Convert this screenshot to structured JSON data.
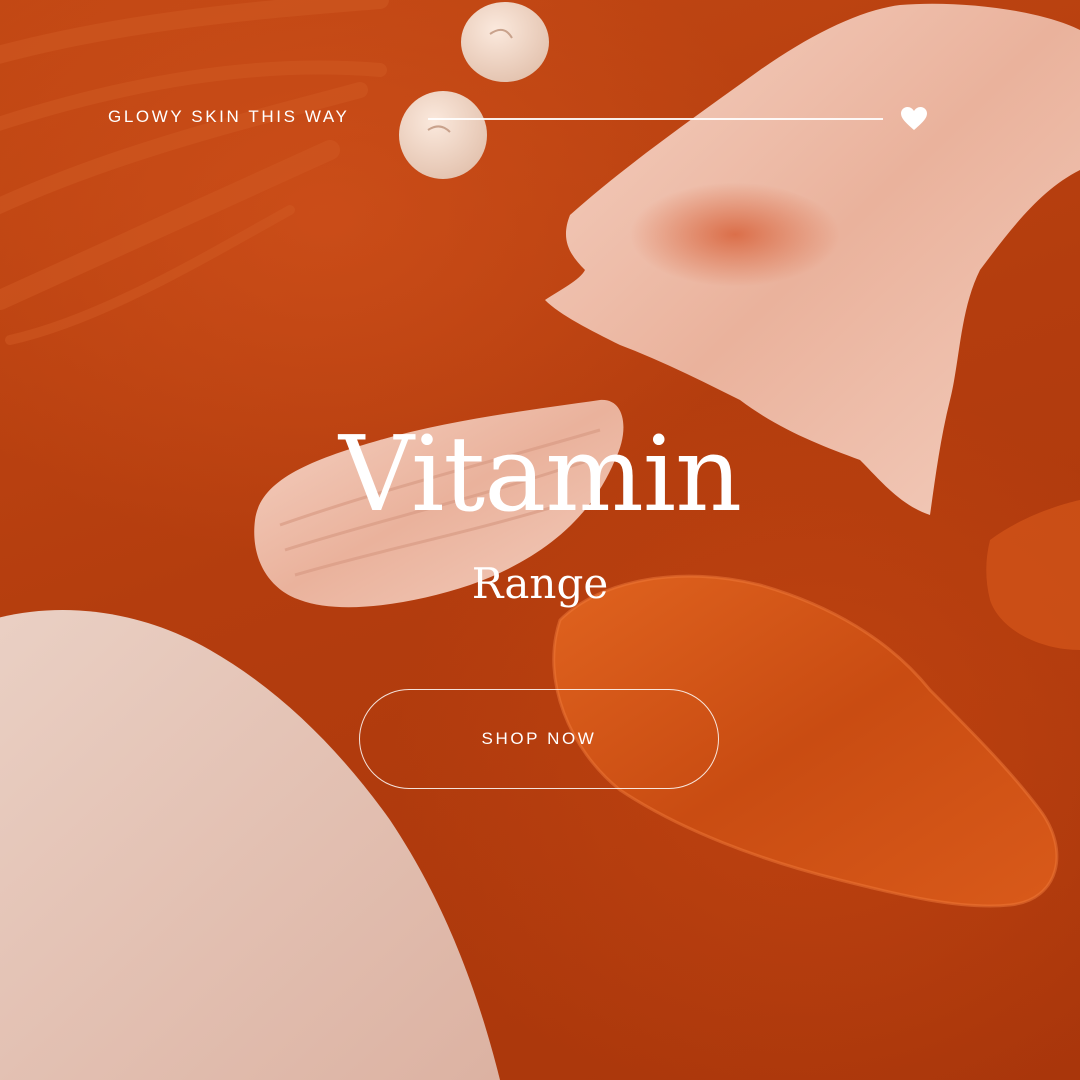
{
  "tagline": "GLOWY SKIN THIS WAY",
  "heading": {
    "title": "Vitamin",
    "subtitle": "Range"
  },
  "cta": {
    "label": "SHOP NOW"
  },
  "icons": {
    "favorite": "heart-icon"
  },
  "colors": {
    "background": "#b8400f",
    "text": "#ffffff",
    "cream": "#f0cbbb",
    "gel": "#cf4f12"
  }
}
